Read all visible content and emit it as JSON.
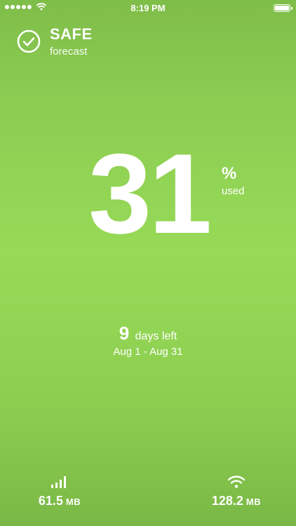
{
  "status_bar": {
    "time": "8:19 PM",
    "signal_icon": "signal-dots-icon",
    "wifi_icon": "wifi-icon",
    "battery_icon": "battery-icon"
  },
  "state": {
    "icon": "check-circle-icon",
    "title": "SAFE",
    "subtitle": "forecast"
  },
  "usage_percent": {
    "value": "31",
    "symbol": "%",
    "label": "used"
  },
  "cycle": {
    "days_left": "9",
    "days_label": "days left",
    "range": "Aug 1 - Aug 31"
  },
  "cellular": {
    "icon": "cellular-bars-icon",
    "value": "61.5",
    "unit": "MB"
  },
  "wifi": {
    "icon": "wifi-icon",
    "value": "128.2",
    "unit": "MB"
  },
  "colors": {
    "background_top": "#7fbd49",
    "background_mid": "#97da57",
    "text": "#ffffff"
  }
}
